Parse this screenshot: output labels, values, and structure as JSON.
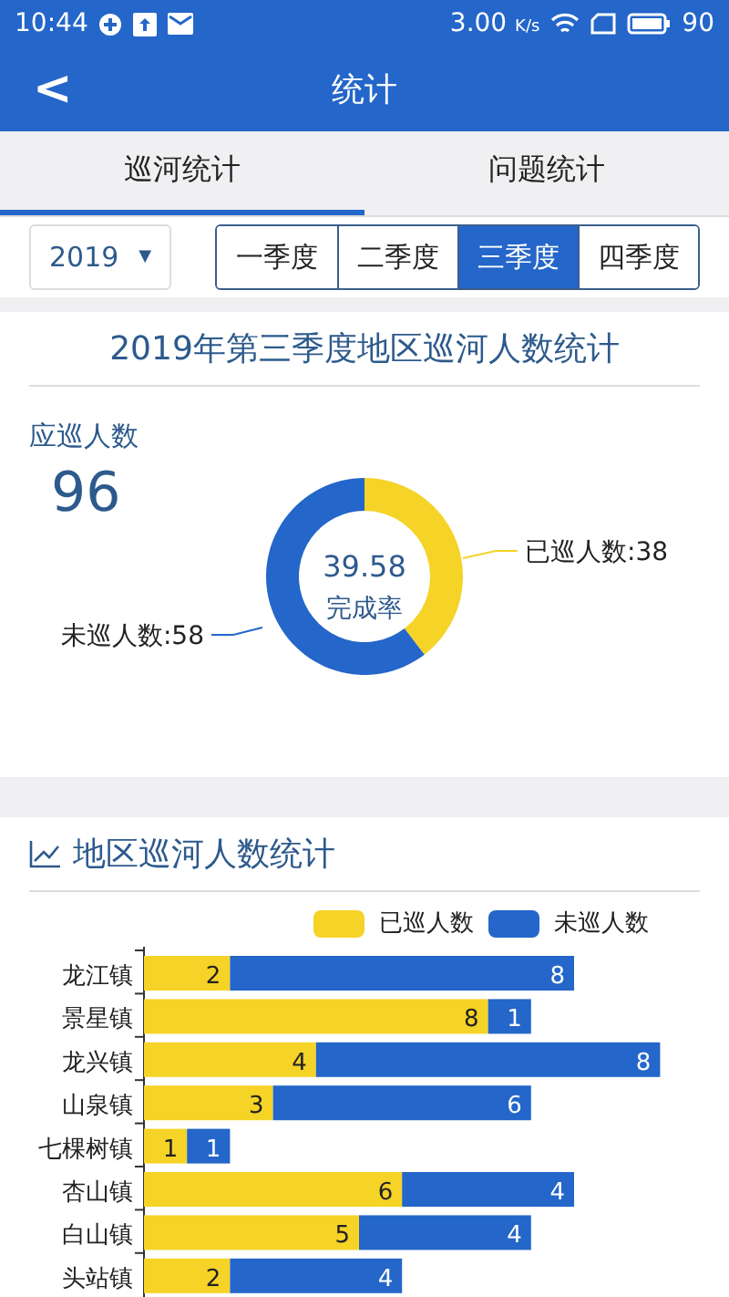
{
  "status_bar": {
    "time": "10:44",
    "speed": "3.00",
    "speed_unit": "K/s",
    "battery": "90"
  },
  "header": {
    "back": "<",
    "title": "统计"
  },
  "tabs": [
    {
      "label": "巡河统计",
      "selected": true
    },
    {
      "label": "问题统计",
      "selected": false
    }
  ],
  "year_select": {
    "value": "2019",
    "caret": "▼"
  },
  "quarters": [
    {
      "label": "一季度",
      "selected": false
    },
    {
      "label": "二季度",
      "selected": false
    },
    {
      "label": "三季度",
      "selected": true
    },
    {
      "label": "四季度",
      "selected": false
    }
  ],
  "summary": {
    "title": "2019年第三季度地区巡河人数统计",
    "total_label": "应巡人数",
    "total": "96",
    "chart_data": {
      "type": "donut",
      "values": [
        39.58,
        60.42
      ],
      "colors": [
        "#f5d327",
        "#2466c9"
      ]
    },
    "slice_labels": [
      "已巡人数:38",
      "未巡人数:58"
    ],
    "rate": "39.58",
    "rate_label": "完成率"
  },
  "region": {
    "title": "地区巡河人数统计",
    "chart_data": {
      "type": "bar",
      "orientation": "horizontal",
      "stacked": true,
      "data_labels": true,
      "categories": [
        "龙江镇",
        "景星镇",
        "龙兴镇",
        "山泉镇",
        "七棵树镇",
        "杏山镇",
        "白山镇",
        "头站镇"
      ],
      "series": [
        {
          "name": "已巡人数",
          "color": "#f5d327",
          "values": [
            2,
            8,
            4,
            3,
            1,
            6,
            5,
            2
          ]
        },
        {
          "name": "未巡人数",
          "color": "#2466c9",
          "values": [
            8,
            1,
            8,
            6,
            1,
            4,
            4,
            4
          ]
        }
      ]
    }
  }
}
